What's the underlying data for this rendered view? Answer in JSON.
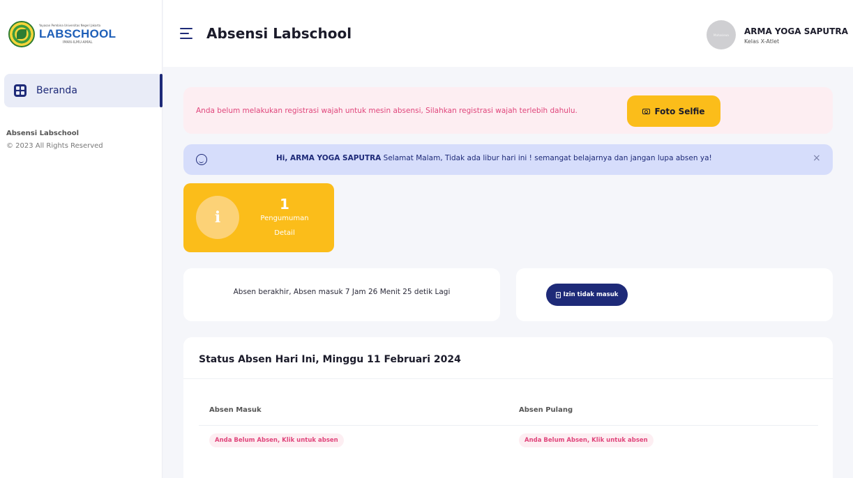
{
  "logo": {
    "subtitle": "Yayasan Pembina Universitas Negeri Jakarta",
    "name": "LABSCHOOL",
    "motto": "IMAN-ILMU-AMAL"
  },
  "sidebar": {
    "items": [
      {
        "label": "Beranda",
        "icon": "dashboard-icon",
        "active": true
      }
    ],
    "footer_title": "Absensi Labschool",
    "footer_copyright": "© 2023 All Rights Reserved"
  },
  "header": {
    "title": "Absensi Labschool",
    "user_name": "ARMA YOGA SAPUTRA",
    "user_class": "Kelas X-Atlet",
    "avatar_text": "Mahasiswa"
  },
  "alerts": {
    "registration_message": "Anda belum melakukan registrasi wajah untuk mesin absensi, Silahkan registrasi wajah terlebih dahulu.",
    "selfie_button": "Foto Selfie",
    "greeting_name": "Hi, ARMA YOGA SAPUTRA",
    "greeting_message": " Selamat Malam, Tidak ada libur hari ini ! semangat belajarnya dan jangan lupa absen ya!",
    "close_symbol": "×"
  },
  "announcement": {
    "count": "1",
    "label": "Pengumuman",
    "detail": "Detail",
    "icon_glyph": "ℹ"
  },
  "timer": {
    "text": "Absen berakhir, Absen masuk 7 Jam 26 Menit 25 detik Lagi"
  },
  "izin": {
    "button": "Izin tidak masuk"
  },
  "status": {
    "title": "Status Absen Hari Ini, Minggu 11 Februari 2024",
    "columns": [
      "Absen Masuk",
      "Absen Pulang"
    ],
    "values": [
      "Anda Belum Absen, Klik untuk absen",
      "Anda Belum Absen, Klik untuk absen"
    ]
  },
  "colors": {
    "primary": "#1e2a78",
    "accent_yellow": "#fbbd1a",
    "alert_pink": "#e0457b",
    "alert_blue_bg": "#d6ddfb"
  }
}
